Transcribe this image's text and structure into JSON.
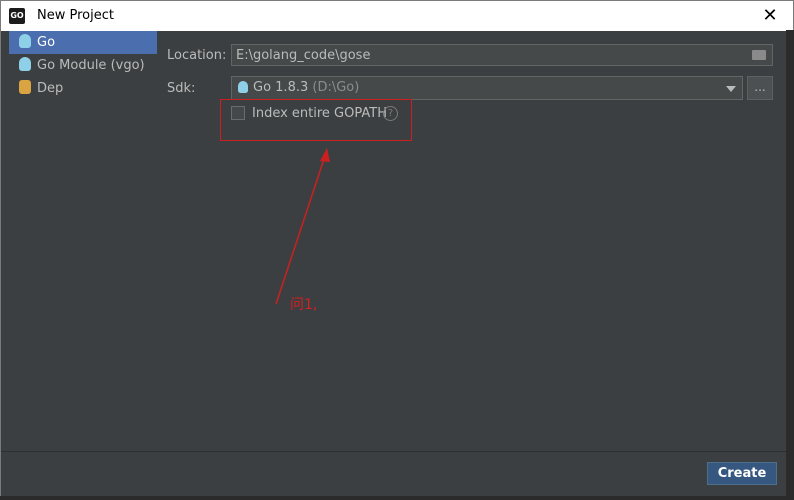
{
  "window": {
    "icon_text": "GO",
    "title": "New Project",
    "close_glyph": "✕"
  },
  "sidebar": {
    "items": [
      {
        "label": "Go",
        "icon": "gopher-icon",
        "selected": true
      },
      {
        "label": "Go Module (vgo)",
        "icon": "gopher-icon",
        "selected": false
      },
      {
        "label": "Dep",
        "icon": "dep-icon",
        "selected": false
      }
    ]
  },
  "form": {
    "location_label": "Location:",
    "location_value": "E:\\golang_code\\gose",
    "sdk_label": "Sdk:",
    "sdk_name": "Go 1.8.3",
    "sdk_path": "(D:\\Go)",
    "ellipsis_label": "...",
    "index_gopath_label": "Index entire GOPATH",
    "index_gopath_checked": false,
    "help_glyph": "?"
  },
  "footer": {
    "create_label": "Create"
  },
  "annotation": {
    "text": "问1,",
    "color": "#cc2020"
  },
  "colors": {
    "background": "#3c3f41",
    "selected": "#4b6eaf",
    "button_primary": "#365880",
    "text": "#bbbbbb"
  }
}
